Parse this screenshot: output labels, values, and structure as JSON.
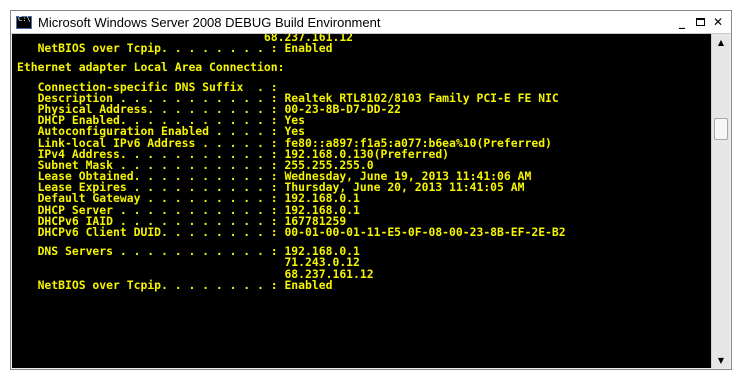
{
  "window": {
    "title": "Microsoft Windows Server 2008 DEBUG Build Environment",
    "minimize_glyph": "_",
    "close_glyph": "✕"
  },
  "scrollbar": {
    "up_glyph": "▲",
    "down_glyph": "▼"
  },
  "console": {
    "lines": [
      "                                    68.237.161.12",
      "   NetBIOS over Tcpip. . . . . . . . : Enabled",
      "",
      "Ethernet adapter Local Area Connection:",
      "",
      "   Connection-specific DNS Suffix  . :",
      "   Description . . . . . . . . . . . : Realtek RTL8102/8103 Family PCI-E FE NIC",
      "   Physical Address. . . . . . . . . : 00-23-8B-D7-DD-22",
      "   DHCP Enabled. . . . . . . . . . . : Yes",
      "   Autoconfiguration Enabled . . . . : Yes",
      "   Link-local IPv6 Address . . . . . : fe80::a897:f1a5:a077:b6ea%10(Preferred)",
      "   IPv4 Address. . . . . . . . . . . : 192.168.0.130(Preferred)",
      "   Subnet Mask . . . . . . . . . . . : 255.255.255.0",
      "   Lease Obtained. . . . . . . . . . : Wednesday, June 19, 2013 11:41:06 AM",
      "   Lease Expires . . . . . . . . . . : Thursday, June 20, 2013 11:41:05 AM",
      "   Default Gateway . . . . . . . . . : 192.168.0.1",
      "   DHCP Server . . . . . . . . . . . : 192.168.0.1",
      "   DHCPv6 IAID . . . . . . . . . . . : 167781259",
      "   DHCPv6 Client DUID. . . . . . . . : 00-01-00-01-11-E5-0F-08-00-23-8B-EF-2E-B2",
      "",
      "   DNS Servers . . . . . . . . . . . : 192.168.0.1",
      "                                       71.243.0.12",
      "                                       68.237.161.12",
      "   NetBIOS over Tcpip. . . . . . . . : Enabled"
    ]
  }
}
